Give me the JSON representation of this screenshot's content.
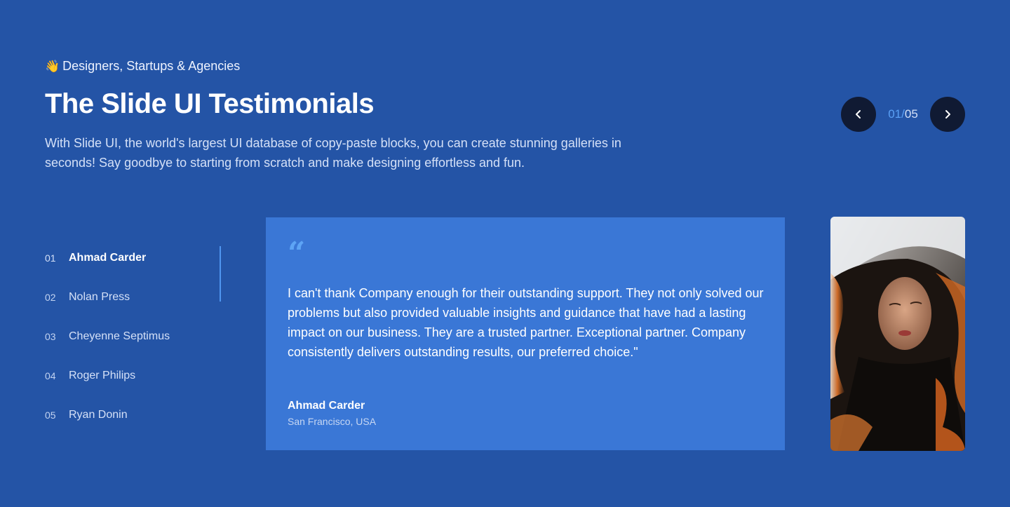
{
  "header": {
    "eyebrow_emoji": "👋",
    "eyebrow": "Designers, Startups & Agencies",
    "title": "The Slide UI Testimonials",
    "description": "With Slide UI, the world's largest UI database of copy-paste blocks, you can create stunning galleries in seconds! Say goodbye to starting from scratch and make designing effortless and fun."
  },
  "pager": {
    "current": "01",
    "separator": "/",
    "total": "05",
    "prev_icon": "chevron-left-icon",
    "next_icon": "chevron-right-icon"
  },
  "people": [
    {
      "num": "01",
      "name": "Ahmad Carder",
      "active": true
    },
    {
      "num": "02",
      "name": "Nolan Press",
      "active": false
    },
    {
      "num": "03",
      "name": "Cheyenne Septimus",
      "active": false
    },
    {
      "num": "04",
      "name": "Roger Philips",
      "active": false
    },
    {
      "num": "05",
      "name": "Ryan Donin",
      "active": false
    }
  ],
  "testimonial": {
    "quote_mark": "“",
    "text": "I can't thank Company enough for their outstanding support. They not only solved our problems but also provided valuable insights and guidance that have had a lasting impact on our business. They are a trusted partner. Exceptional partner. Company consistently delivers outstanding results, our preferred choice.\"",
    "author": "Ahmad Carder",
    "location": "San Francisco, USA"
  },
  "colors": {
    "background": "#2454a6",
    "card": "#3a77d6",
    "accent": "#4f96f0",
    "nav_button": "#101a33"
  }
}
